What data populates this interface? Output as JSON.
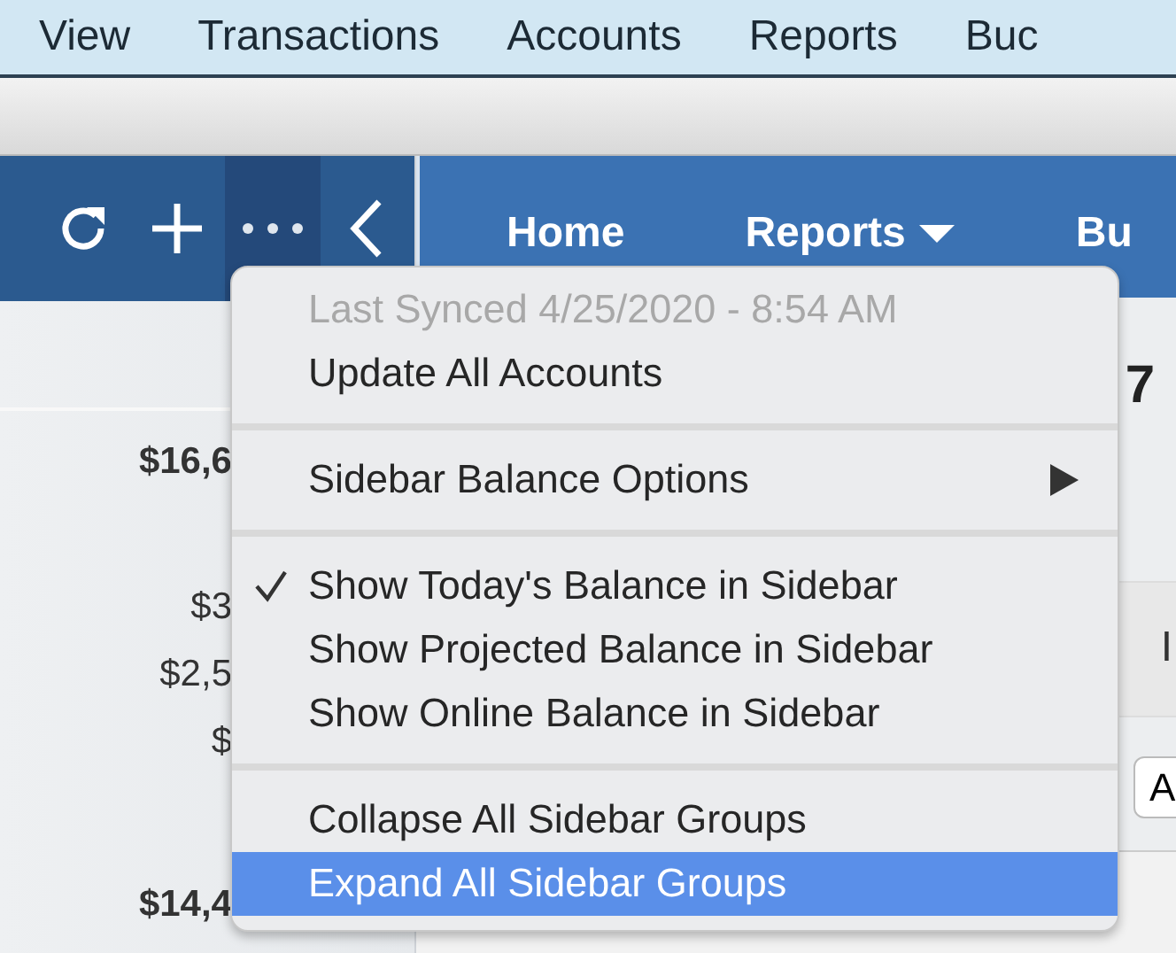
{
  "menu_bar": [
    {
      "label": "View"
    },
    {
      "label": "Transactions"
    },
    {
      "label": "Accounts"
    },
    {
      "label": "Reports"
    },
    {
      "label": "Buc"
    }
  ],
  "sidebar_tools": {
    "more_pressed": true
  },
  "nav_tabs": [
    {
      "label": "Home",
      "dropdown": false
    },
    {
      "label": "Reports",
      "dropdown": true
    },
    {
      "label": "Bu",
      "dropdown": false
    }
  ],
  "sidebar": {
    "balances": [
      {
        "text": "$16,6",
        "kind": "total"
      },
      {
        "text": "$3",
        "kind": "account"
      },
      {
        "text": "$2,5",
        "kind": "account"
      },
      {
        "text": "$",
        "kind": "account"
      },
      {
        "text": "$14,4",
        "kind": "total"
      }
    ]
  },
  "main": {
    "heading_fragment": "7",
    "row_fragment": "I",
    "button_fragment": "A"
  },
  "menu": {
    "items": [
      {
        "kind": "item",
        "label": "Last Synced 4/25/2020 - 8:54 AM",
        "disabled": true,
        "checked": false,
        "highlighted": false,
        "submenu": false
      },
      {
        "kind": "item",
        "label": "Update All Accounts",
        "disabled": false,
        "checked": false,
        "highlighted": false,
        "submenu": false
      },
      {
        "kind": "separator"
      },
      {
        "kind": "item",
        "label": "Sidebar Balance Options",
        "disabled": false,
        "checked": false,
        "highlighted": false,
        "submenu": true
      },
      {
        "kind": "separator"
      },
      {
        "kind": "item",
        "label": "Show Today's Balance in Sidebar",
        "disabled": false,
        "checked": true,
        "highlighted": false,
        "submenu": false
      },
      {
        "kind": "item",
        "label": "Show Projected Balance in Sidebar",
        "disabled": false,
        "checked": false,
        "highlighted": false,
        "submenu": false
      },
      {
        "kind": "item",
        "label": "Show Online Balance in Sidebar",
        "disabled": false,
        "checked": false,
        "highlighted": false,
        "submenu": false
      },
      {
        "kind": "separator"
      },
      {
        "kind": "item",
        "label": "Collapse All Sidebar Groups",
        "disabled": false,
        "checked": false,
        "highlighted": false,
        "submenu": false
      },
      {
        "kind": "item",
        "label": "Expand All Sidebar Groups",
        "disabled": false,
        "checked": false,
        "highlighted": true,
        "submenu": false
      }
    ]
  }
}
